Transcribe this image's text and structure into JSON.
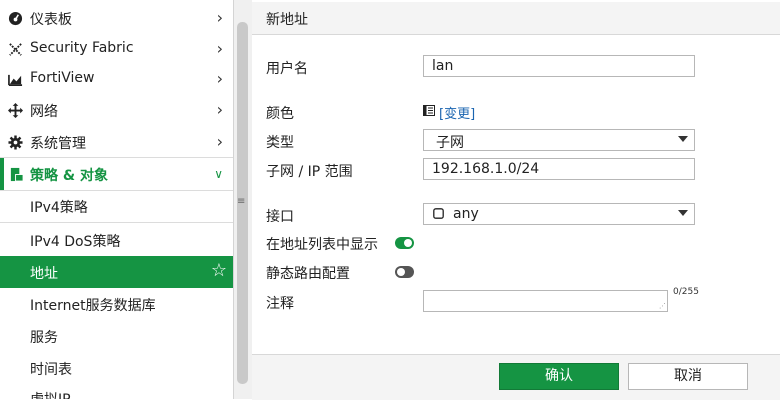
{
  "sidebar": {
    "items": [
      {
        "label": "仪表板",
        "icon": "dashboard-icon"
      },
      {
        "label": "Security Fabric",
        "icon": "security-fabric-icon"
      },
      {
        "label": "FortiView",
        "icon": "fortiview-icon"
      },
      {
        "label": "网络",
        "icon": "network-icon"
      },
      {
        "label": "系统管理",
        "icon": "gear-icon"
      },
      {
        "label": "策略 & 对象",
        "icon": "policy-icon",
        "expanded": true
      },
      {
        "label": "IPv4策略"
      },
      {
        "label": "IPv4 DoS策略"
      },
      {
        "label": "地址",
        "active": true,
        "icon": "star-icon"
      },
      {
        "label": "Internet服务数据库"
      },
      {
        "label": "服务"
      },
      {
        "label": "时间表"
      },
      {
        "label": "虚拟IP"
      }
    ]
  },
  "header": {
    "title": "新地址"
  },
  "form": {
    "name_label": "用户名",
    "name_value": "lan",
    "color_label": "颜色",
    "color_change": "[变更]",
    "type_label": "类型",
    "type_value": "子网",
    "subnet_label": "子网 / IP 范围",
    "subnet_value": "192.168.1.0/24",
    "interface_label": "接口",
    "interface_value": "any",
    "show_in_list_label": "在地址列表中显示",
    "show_in_list": true,
    "static_route_label": "静态路由配置",
    "static_route": false,
    "comment_label": "注释",
    "comment_value": "",
    "comment_count": "0/255"
  },
  "footer": {
    "ok_label": "确认",
    "cancel_label": "取消"
  },
  "colors": {
    "accent": "#159443",
    "link": "#1a64b0"
  }
}
